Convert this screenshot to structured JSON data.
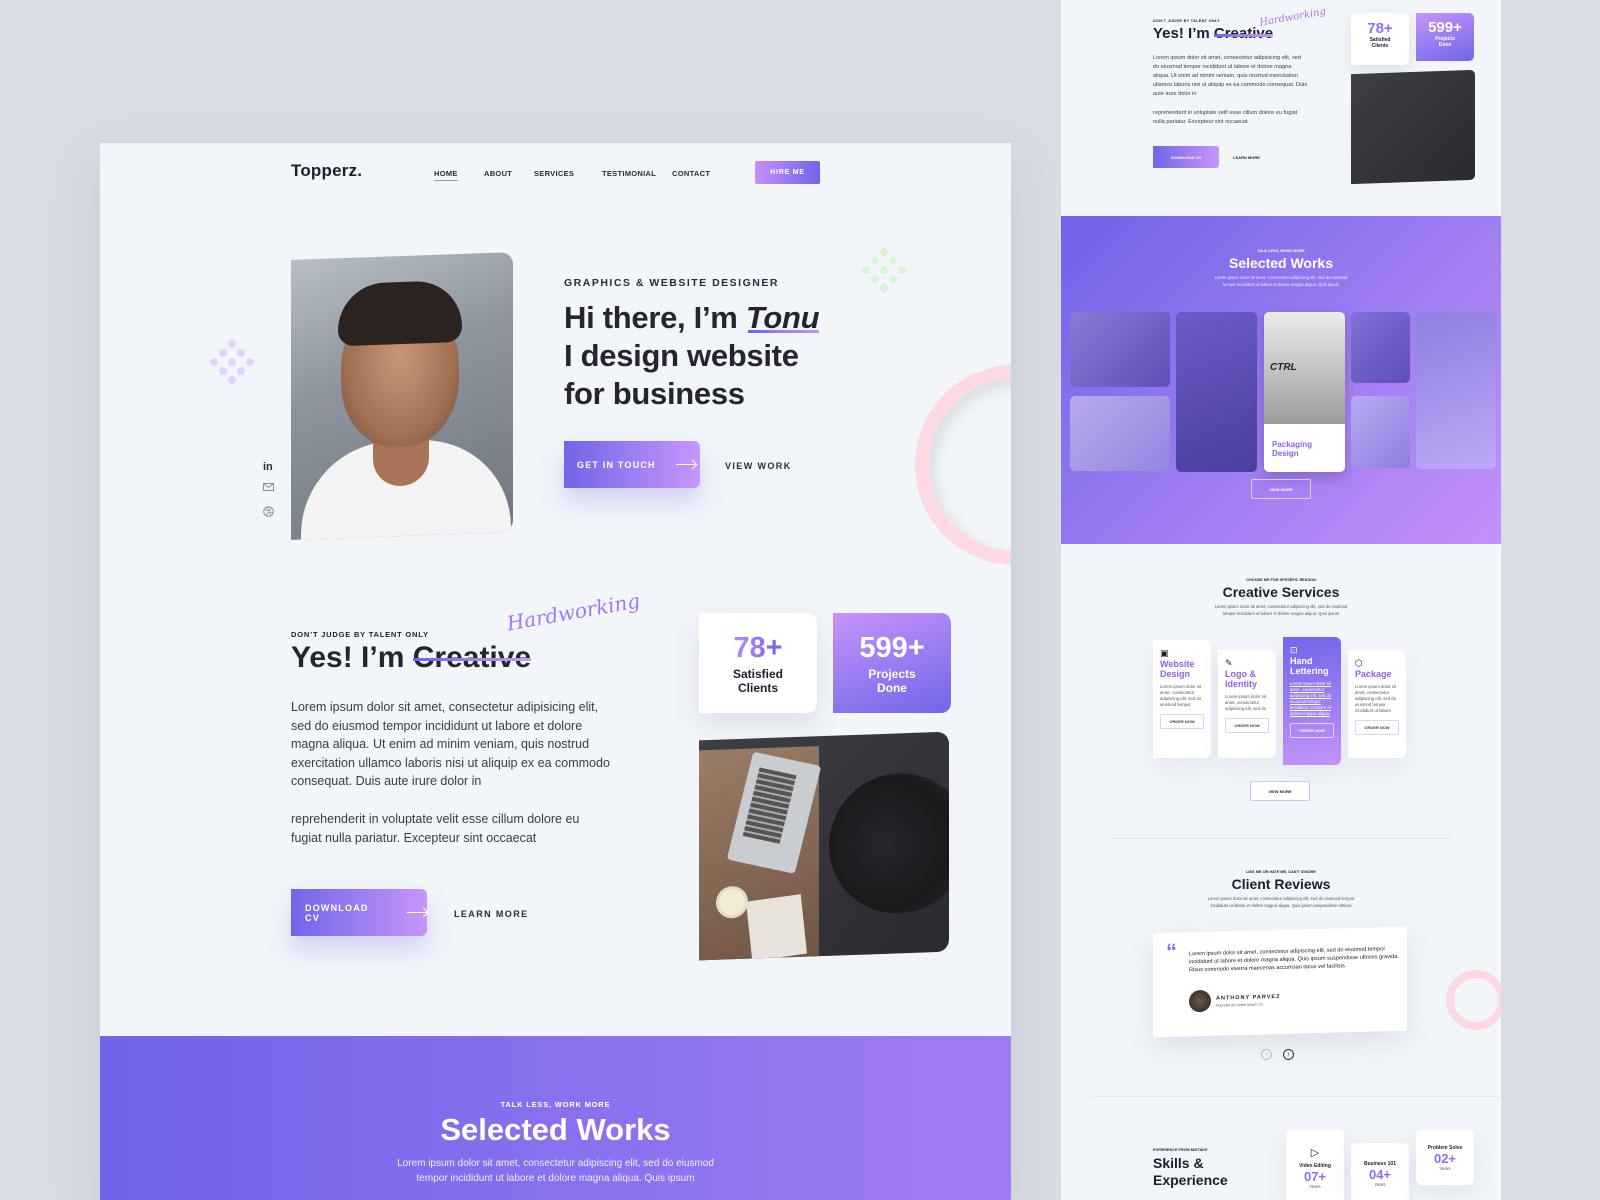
{
  "colors": {
    "accent_start": "#7165e8",
    "accent_end": "#c895fb",
    "text_dark": "#24252f",
    "ring_pink": "#fcd9e3",
    "dots_green": "#d9f4d4",
    "dots_purple": "#dcd6fb"
  },
  "header": {
    "logo": "Topperz.",
    "nav": [
      "HOME",
      "ABOUT",
      "SERVICES",
      "TESTIMONIAL",
      "CONTACT"
    ],
    "active_nav": "HOME",
    "hire_button": "HIRE ME"
  },
  "hero": {
    "eyebrow": "GRAPHICS & WEBSITE DESIGNER",
    "title_line1_prefix": "Hi there, I’m ",
    "title_name": "Tonu",
    "title_line2": "I design website",
    "title_line3": "for business",
    "primary_button": "GET IN TOUCH",
    "secondary_link": "VIEW WORK",
    "social_icons": [
      "linkedin-icon",
      "mail-icon",
      "dribbble-icon"
    ]
  },
  "about": {
    "eyebrow": "DON’T JUDGE BY TALENT ONLY",
    "title_prefix": "Yes! I’m ",
    "title_struck": "Creative",
    "title_script": "Hardworking",
    "paragraph1": "Lorem ipsum dolor sit amet, consectetur adipisicing elit, sed do eiusmod tempor incididunt ut labore et dolore magna aliqua. Ut enim ad minim veniam, quis nostrud exercitation ullamco laboris nisi ut aliquip ex ea commodo consequat. Duis aute irure dolor in",
    "paragraph2": "reprehenderit in voluptate velit esse cillum dolore eu fugiat nulla pariatur. Excepteur sint occaecat",
    "primary_button": "DOWNLOAD CV",
    "secondary_link": "LEARN MORE",
    "stats": [
      {
        "value": "78+",
        "label_line1": "Satisfied",
        "label_line2": "Clients"
      },
      {
        "value": "599+",
        "label_line1": "Projects",
        "label_line2": "Done"
      }
    ]
  },
  "works": {
    "eyebrow": "TALK LESS, WORK MORE",
    "title": "Selected Works",
    "desc_line1": "Lorem ipsum dolor sit amet, consectetur adipiscing elit, sed do eiusmod",
    "desc_line2": "tempor incididunt ut labore et dolore magna aliqua. Quis ipsum",
    "featured_label_line1": "Packaging",
    "featured_label_line2": "Design",
    "featured_mock_text": "CTRL",
    "view_more": "VIEW MORE"
  },
  "services": {
    "eyebrow": "CHOOSE ME FOR SPESEFIC REASON",
    "title": "Creative Services",
    "desc_line1": "Lorem ipsum dolor sit amet, consectetur adipiscing elit, sed do eiusmod",
    "desc_line2": "tempor incididunt ut labore et dolore magna aliqua. Quis ipsum",
    "cards": [
      {
        "title_line1": "Website",
        "title_line2": "Design",
        "desc": "Lorem ipsum dolor sit amet, consectetur adipiscing elit, sed do eiusmod tempor",
        "button": "ORDER NOW",
        "icon": "browser-icon"
      },
      {
        "title_line1": "Logo &",
        "title_line2": "Identity",
        "desc": "Lorem ipsum dolor sit amet, consectetur adipiscing elit, sed do",
        "button": "ORDER NOW",
        "icon": "pen-tool-icon"
      },
      {
        "title_line1": "Hand",
        "title_line2": "Lettering",
        "desc": "Lorem ipsum dolor sit amet, consectetur adipiscing elit, sed do eiusmod tempor incididunt ut labore et dolore magna aliqua.",
        "button": "ORDER NOW",
        "icon": "text-frame-icon"
      },
      {
        "title_line1": "Package",
        "title_line2": "",
        "desc": "Lorem ipsum dolor sit amet, consectetur adipiscing elit, sed do eiusmod tempor incididunt ut labore",
        "button": "ORDER NOW",
        "icon": "box-icon"
      }
    ],
    "view_more": "VIEW MORE"
  },
  "reviews": {
    "eyebrow": "LIKE ME OR HATE ME, CAN’T IGNORE",
    "title": "Client Reviews",
    "desc_line1": "Lorem ipsum dolor sit amet, consectetur adipiscing elit, sed do eiusmod tempor",
    "desc_line2": "incididunt ut labore et dolore magna aliqua. Quis ipsum suspendisse ultrices",
    "quote": "Lorem ipsum dolor sit amet, consectetur adipiscing elit, sed do eiusmod tempor incididunt ut labore et dolore magna aliqua. Quis ipsum suspendisse ultrices gravida. Risus commodo viverra maecenas accumsan lacus vel facilisis.",
    "author": "ANTHONY PARVEZ",
    "author_role": "Founder of Lorem Ipsum co."
  },
  "skills": {
    "eyebrow": "EXPERIENCE FROM MISTAKE",
    "title_line1": "Skills &",
    "title_line2": "Experience",
    "items": [
      {
        "label": "Video Editing",
        "value": "07+",
        "unit": "Years"
      },
      {
        "label": "Business 101",
        "value": "04+",
        "unit": "Years"
      },
      {
        "label": "Problem Solve",
        "value": "02+",
        "unit": "Years"
      }
    ]
  }
}
